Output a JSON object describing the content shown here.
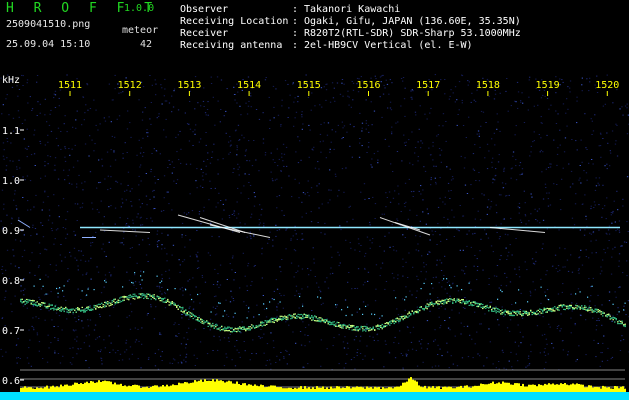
{
  "header": {
    "app_title": "H R O F F T",
    "version": "1.0.0",
    "filename": "2509041510.png",
    "datetime": "25.09.04 15:10",
    "meteor_label": "meteor",
    "meteor_count": "42",
    "info": [
      {
        "key": "Observer",
        "value": "Takanori Kawachi"
      },
      {
        "key": "Receiving Location",
        "value": "Ogaki, Gifu, JAPAN (136.60E, 35.35N)"
      },
      {
        "key": "Receiver",
        "value": "R820T2(RTL-SDR) SDR-Sharp 53.1000MHz"
      },
      {
        "key": "Receiving antenna",
        "value": "2el-HB9CV Vertical (el. E-W)"
      }
    ]
  },
  "plot": {
    "y_unit": "kHz",
    "y_ticks": [
      "1.1",
      "1.0",
      "0.9",
      "0.8",
      "0.7",
      "0.6"
    ],
    "x_ticks": [
      "1511",
      "1512",
      "1513",
      "1514",
      "1515",
      "1516",
      "1517",
      "1518",
      "1519",
      "1520"
    ],
    "colors": {
      "background": "#000000",
      "noise": "#1f2a7a",
      "carrier": "#8fe8ff",
      "echo": "#ffffff",
      "baseline_band": "#2fb07a",
      "activity_bar": "#ffff00",
      "bottom_band": "#00e0ff",
      "tick_text": "#ffff00",
      "axis_text": "#ffffff"
    }
  }
}
